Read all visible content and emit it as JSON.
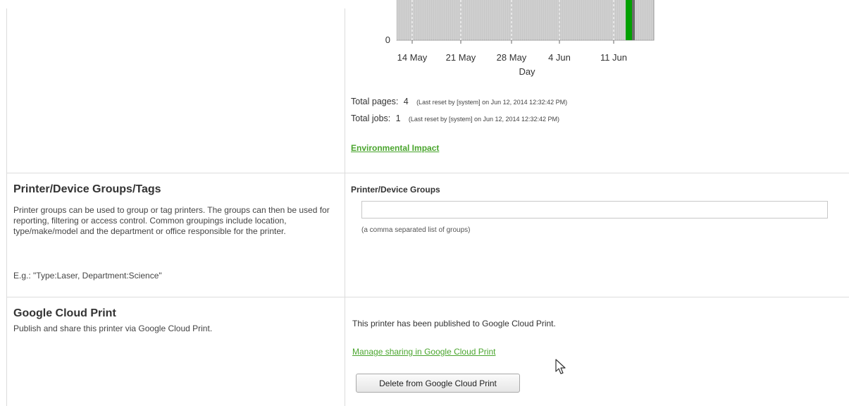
{
  "usage_chart": {
    "chart_data": {
      "type": "bar",
      "xlabel": "Day",
      "x_ticks": [
        "14 May",
        "21 May",
        "28 May",
        "4 Jun",
        "11 Jun"
      ],
      "y_ticks": [
        "0"
      ],
      "series": [
        {
          "values": [
            4
          ],
          "color": "#00a000"
        }
      ],
      "highlight_day": "12 Jun",
      "grid": true
    }
  },
  "stats": {
    "total_pages_label": "Total pages:",
    "total_pages_value": "4",
    "total_pages_note": "(Last reset by [system] on Jun 12, 2014 12:32:42 PM)",
    "total_jobs_label": "Total jobs:",
    "total_jobs_value": "1",
    "total_jobs_note": "(Last reset by [system] on Jun 12, 2014 12:32:42 PM)",
    "environmental_link": "Environmental Impact"
  },
  "groups_section": {
    "title": "Printer/Device Groups/Tags",
    "description": "Printer groups can be used to group or tag printers. The groups can then be used for reporting, filtering or access control. Common groupings include location, type/make/model and the department or office responsible for the printer.",
    "example": "E.g.: \"Type:Laser, Department:Science\"",
    "field_label": "Printer/Device Groups",
    "field_value": "",
    "field_placeholder": "",
    "hint": "(a comma separated list of groups)"
  },
  "gcp_section": {
    "title": "Google Cloud Print",
    "description": "Publish and share this printer via Google Cloud Print.",
    "status": "This printer has been published to Google Cloud Print.",
    "manage_link": "Manage sharing in Google Cloud Print",
    "delete_button": "Delete from Google Cloud Print"
  },
  "colors": {
    "link_green": "#4aa52e",
    "bar_green": "#00a000",
    "chart_bg": "#c8c8c8",
    "border": "#dcdcdc"
  }
}
